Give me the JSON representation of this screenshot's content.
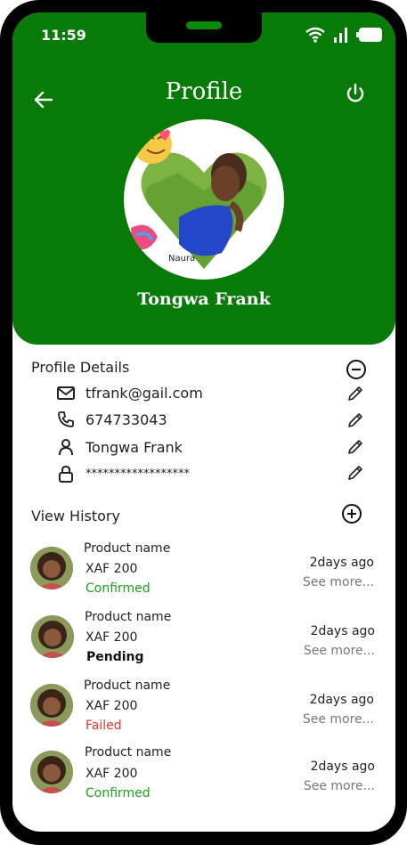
{
  "status_bar": {
    "time": "11:59"
  },
  "header": {
    "title": "Profile",
    "user_name": "Tongwa Frank",
    "photo_badge": "Naura"
  },
  "profile_details": {
    "title": "Profile Details",
    "email": "tfrank@gail.com",
    "phone": "674733043",
    "name": "Tongwa Frank",
    "password": "******************"
  },
  "view_history": {
    "title": "View History",
    "items": [
      {
        "name": "Product name",
        "price": "XAF 200",
        "status": "Confirmed",
        "ago": "2days ago",
        "more": "See more..."
      },
      {
        "name": "Product name",
        "price": "XAF 200",
        "status": "Pending",
        "ago": "2days ago",
        "more": "See more..."
      },
      {
        "name": "Product name",
        "price": "XAF 200",
        "status": "Failed",
        "ago": "2days ago",
        "more": "See more..."
      },
      {
        "name": "Product name",
        "price": "XAF 200",
        "status": "Confirmed",
        "ago": "2days ago",
        "more": "See more..."
      }
    ]
  },
  "colors": {
    "brand_green": "#087a07",
    "confirmed": "#1aa21a",
    "failed": "#ee3333"
  }
}
